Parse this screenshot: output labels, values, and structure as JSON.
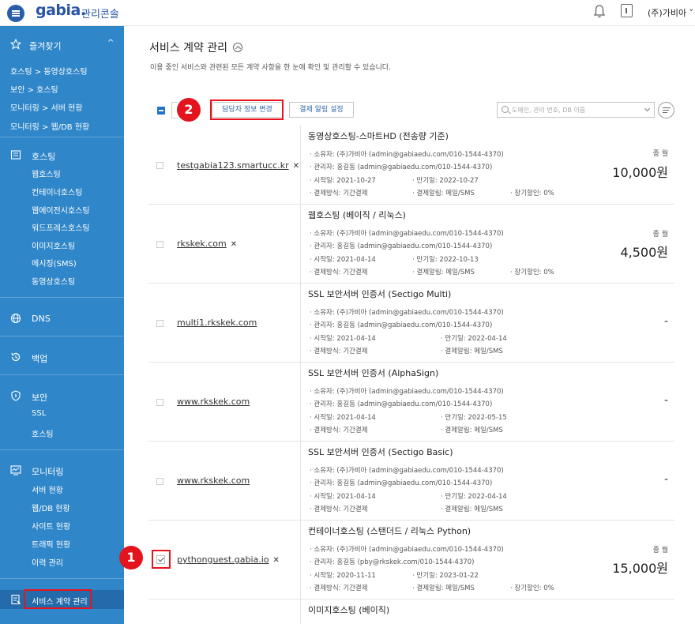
{
  "header": {
    "logo": "gabia.",
    "console": "관리콘솔",
    "user": "(주)가비아 ˅"
  },
  "sidebar": {
    "favorites": {
      "label": "즐겨찾기",
      "items": [
        "호스팅 > 동영상호스팅",
        "보안 > 호스팅",
        "모니터링 > 서버 현황",
        "모니터링 > 웹/DB 현황"
      ]
    },
    "sections": [
      {
        "label": "호스팅",
        "items": [
          "웹호스팅",
          "컨테이너호스팅",
          "웹에이전시호스팅",
          "워드프레스호스팅",
          "이미지호스팅",
          "메시징(SMS)",
          "동영상호스팅"
        ]
      },
      {
        "label": "DNS",
        "items": []
      },
      {
        "label": "백업",
        "items": []
      },
      {
        "label": "보안",
        "items": [
          "SSL",
          "호스팅"
        ]
      },
      {
        "label": "모니터링",
        "items": [
          "서버 현황",
          "웹/DB 현황",
          "사이트 현황",
          "트래픽 현황",
          "이력 관리"
        ]
      }
    ],
    "active_item": "서비스 계약 관리"
  },
  "main": {
    "title": "서비스 계약 관리",
    "description": "이용 중인 서비스와 관련된 모든 계약 사항을 한 눈에 확인 및 관리할 수 있습니다.",
    "toolbar": {
      "change_contact_btn": "담당자 정보 변경",
      "payment_alert_btn": "결제 알림 설정",
      "search_placeholder": "도메인, 관리 번호, DB 이름"
    },
    "badges": {
      "one": "1",
      "two": "2"
    },
    "rows": [
      {
        "domain": "testgabia123.smartucc.kr",
        "service": "동영상호스팅-스마트HD (전송량 기준)",
        "owner": "· 소유자: (주)가비아 (admin@gabiaedu.com/010-1544-4370)",
        "manager": "· 관리자: 홍길동 (admin@gabiaedu.com/010-1544-4370)",
        "start": "· 시작일: 2021-10-27",
        "expire": "· 만기일: 2022-10-27",
        "pay_method": "· 결제방식: 기간결제",
        "pay_alert": "· 결제알림: 메일/SMS",
        "discount": "· 장기할인: 0%",
        "price_label": "종 월",
        "price": "10,000원"
      },
      {
        "domain": "rkskek.com",
        "service": "웹호스팅 (베이직 / 리눅스)",
        "owner": "· 소유자: (주)가비아 (admin@gabiaedu.com/010-1544-4370)",
        "manager": "· 관리자: 홍길동 (admin@gabiaedu.com/010-1544-4370)",
        "start": "· 시작일: 2021-04-14",
        "expire": "· 만기일: 2022-10-13",
        "pay_method": "· 결제방식: 기간결제",
        "pay_alert": "· 결제알림: 메일/SMS",
        "discount": "· 장기할인: 0%",
        "price_label": "종 월",
        "price": "4,500원"
      },
      {
        "domain": "multi1.rkskek.com",
        "service": "SSL 보안서버 인증서 (Sectigo Multi)",
        "owner": "· 소유자: (주)가비아 (admin@gabiaedu.com/010-1544-4370)",
        "manager": "· 관리자: 홍길동 (admin@gabiaedu.com/010-1544-4370)",
        "start": "· 시작일: 2021-04-14",
        "expire": "· 만기일: 2022-04-14",
        "pay_method": "· 결제방식: 기간결제",
        "pay_alert": "· 결제알림: 메일/SMS",
        "price": "-"
      },
      {
        "domain": "www.rkskek.com",
        "service": "SSL 보안서버 인증서 (AlphaSign)",
        "owner": "· 소유자: (주)가비아 (admin@gabiaedu.com/010-1544-4370)",
        "manager": "· 관리자: 홍길동 (admin@gabiaedu.com/010-1544-4370)",
        "start": "· 시작일: 2021-04-14",
        "expire": "· 만기일: 2022-05-15",
        "pay_method": "· 결제방식: 기간결제",
        "pay_alert": "· 결제알림: 메일/SMS",
        "price": "-"
      },
      {
        "domain": "www.rkskek.com",
        "service": "SSL 보안서버 인증서 (Sectigo Basic)",
        "owner": "· 소유자: (주)가비아 (admin@gabiaedu.com/010-1544-4370)",
        "manager": "· 관리자: 홍길동 (admin@gabiaedu.com/010-1544-4370)",
        "start": "· 시작일: 2021-04-14",
        "expire": "· 만기일: 2022-04-14",
        "pay_method": "· 결제방식: 기간결제",
        "pay_alert": "· 결제알림: 메일/SMS",
        "price": "-"
      },
      {
        "domain": "pythonguest.gabia.io",
        "service": "컨테이너호스팅 (스탠더드 / 리눅스 Python)",
        "owner": "· 소유자: (주)가비아 (admin@gabiaedu.com/010-1544-4370)",
        "manager": "· 관리자: 홍길동 (pby@rkskek.com/010-1544-4370)",
        "start": "· 시작일: 2020-11-11",
        "expire": "· 만기일: 2023-01-22",
        "pay_method": "· 결제방식: 기간결제",
        "pay_alert": "· 결제알림: 메일/SMS",
        "discount": "· 장기할인: 0%",
        "price_label": "종 월",
        "price": "15,000원"
      },
      {
        "service": "이미지호스팅 (베이직)"
      }
    ],
    "x_mark": "✕"
  }
}
